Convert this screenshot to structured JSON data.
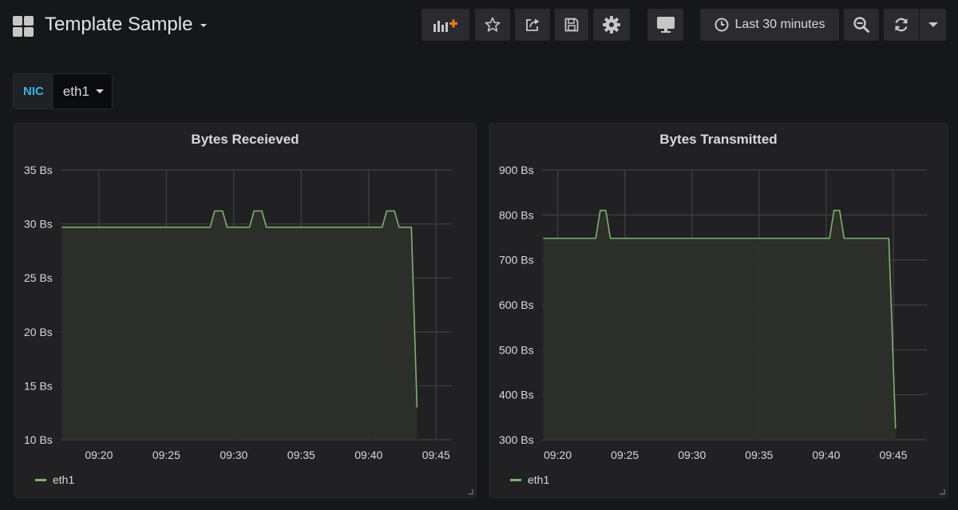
{
  "header": {
    "title": "Template Sample",
    "time_range": "Last 30 minutes",
    "buttons": [
      "add-panel-icon",
      "star-icon",
      "share-icon",
      "save-icon",
      "gear-icon",
      "monitor-icon",
      "clock-icon",
      "zoom-out-icon",
      "refresh-icon",
      "chevron-down-icon"
    ]
  },
  "variable": {
    "label": "NIC",
    "value": "eth1"
  },
  "colors": {
    "series": "#7eb26d",
    "grid": "#464648",
    "panel_bg": "#212124",
    "accent": "#33b5e5"
  },
  "panels": [
    {
      "title": "Bytes Receieved",
      "legend": "eth1",
      "y_ticks": [
        "35 Bs",
        "30 Bs",
        "25 Bs",
        "20 Bs",
        "15 Bs",
        "10 Bs"
      ],
      "x_ticks": [
        "09:20",
        "09:25",
        "09:30",
        "09:35",
        "09:40",
        "09:45"
      ],
      "chart_data": {
        "type": "area",
        "xlabel": "",
        "ylabel": "",
        "ylim": [
          10,
          35
        ],
        "xlim": [
          "09:17:10",
          "09:46:10"
        ],
        "series": [
          {
            "name": "eth1",
            "x": [
              "09:17:15",
              "09:28:15",
              "09:28:35",
              "09:29:10",
              "09:29:30",
              "09:31:10",
              "09:31:30",
              "09:32:05",
              "09:32:25",
              "09:41:00",
              "09:41:20",
              "09:41:55",
              "09:42:15",
              "09:43:10",
              "09:43:35"
            ],
            "values": [
              29.7,
              29.7,
              31.2,
              31.2,
              29.7,
              29.7,
              31.2,
              31.2,
              29.7,
              29.7,
              31.2,
              31.2,
              29.7,
              29.7,
              13.0
            ]
          }
        ]
      }
    },
    {
      "title": "Bytes Transmitted",
      "legend": "eth1",
      "y_ticks": [
        "900 Bs",
        "800 Bs",
        "700 Bs",
        "600 Bs",
        "500 Bs",
        "400 Bs",
        "300 Bs"
      ],
      "x_ticks": [
        "09:20",
        "09:25",
        "09:30",
        "09:35",
        "09:40",
        "09:45"
      ],
      "chart_data": {
        "type": "area",
        "xlabel": "",
        "ylabel": "",
        "ylim": [
          300,
          900
        ],
        "xlim": [
          "09:18:50",
          "09:47:30"
        ],
        "series": [
          {
            "name": "eth1",
            "x": [
              "09:18:55",
              "09:22:50",
              "09:23:10",
              "09:23:35",
              "09:23:55",
              "09:40:15",
              "09:40:35",
              "09:41:00",
              "09:41:20",
              "09:44:40",
              "09:45:10"
            ],
            "values": [
              748,
              748,
              810,
              810,
              748,
              748,
              810,
              810,
              748,
              748,
              325
            ]
          }
        ]
      }
    }
  ]
}
